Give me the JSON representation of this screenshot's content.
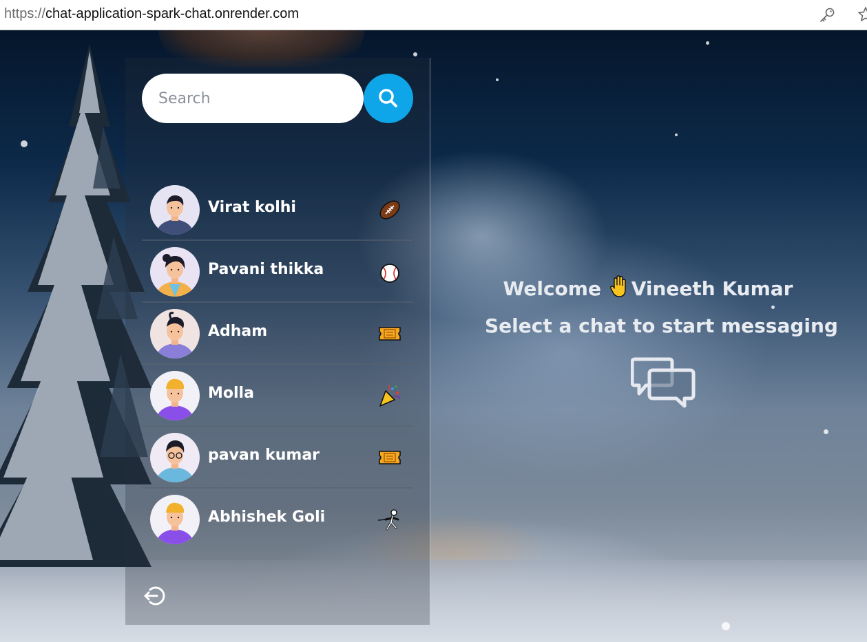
{
  "browser": {
    "url_scheme": "https://",
    "url_host": "chat-application-spark-chat.onrender.com",
    "icons": [
      "key-icon",
      "star-icon"
    ]
  },
  "sidebar": {
    "search": {
      "placeholder": "Search",
      "value": "",
      "icon": "search-icon"
    },
    "chats": [
      {
        "name": "Virat kolhi",
        "emoji_icon": "football-icon"
      },
      {
        "name": "Pavani thikka",
        "emoji_icon": "baseball-icon"
      },
      {
        "name": "Adham",
        "emoji_icon": "ticket-icon"
      },
      {
        "name": "Molla",
        "emoji_icon": "party-popper-icon"
      },
      {
        "name": "pavan kumar",
        "emoji_icon": "ticket-icon"
      },
      {
        "name": "Abhishek Goli",
        "emoji_icon": "fencer-icon"
      }
    ],
    "logout_icon": "logout-icon"
  },
  "welcome": {
    "greeting": "Welcome",
    "user_name": "Vineeth Kumar",
    "hand_icon": "raised-hand-icon",
    "subtitle": "Select a chat to start messaging",
    "icon": "chat-bubbles-icon"
  },
  "colors": {
    "search_button": "#0ea5e9",
    "text_primary": "#ffffff",
    "welcome_text": "#e8ecf1"
  }
}
